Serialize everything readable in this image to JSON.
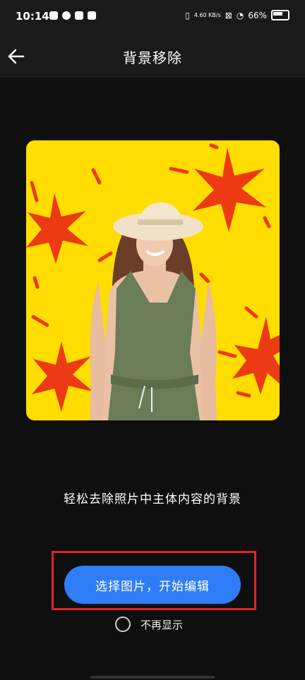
{
  "status_bar": {
    "time": "10:14",
    "net_speed": "4.60 KB/s",
    "battery": "66%"
  },
  "header": {
    "title": "背景移除"
  },
  "preview": {
    "alt": "woman in sun hat on yellow background with red stars"
  },
  "main": {
    "description": "轻松去除照片中主体内容的背景",
    "primary_button": "选择图片，开始编辑",
    "dont_show_again": "不再显示"
  },
  "colors": {
    "accent": "#2f7df6",
    "highlight": "#e0242a",
    "preview_bg": "#ffdd00"
  }
}
